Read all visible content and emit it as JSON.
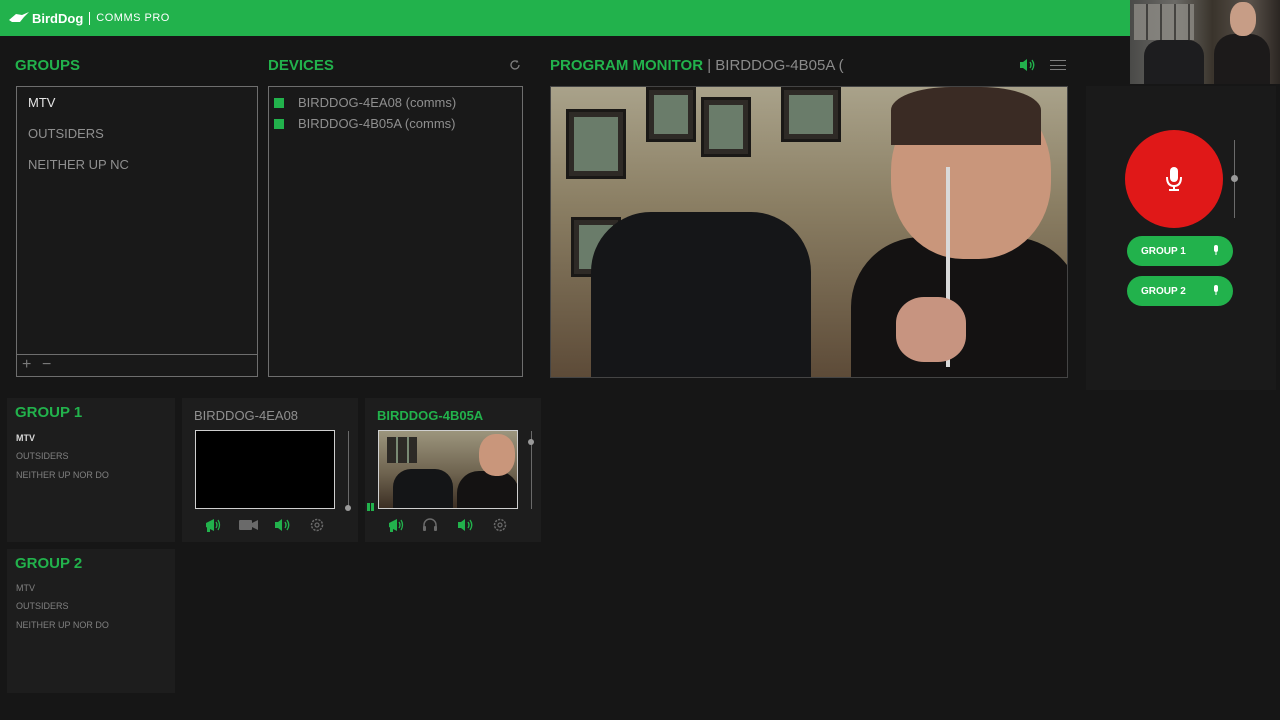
{
  "app": {
    "brand": "BirdDog",
    "product": "COMMS PRO"
  },
  "colors": {
    "accent": "#22b24c",
    "talk": "#e01818",
    "background": "#161616"
  },
  "groups_panel": {
    "title": "GROUPS",
    "items": [
      "MTV",
      "OUTSIDERS",
      "NEITHER UP NC"
    ],
    "add_label": "+",
    "remove_label": "−"
  },
  "devices_panel": {
    "title": "DEVICES",
    "items": [
      "BIRDDOG-4EA08 (comms)",
      "BIRDDOG-4B05A (comms)"
    ]
  },
  "program_monitor": {
    "title": "PROGRAM MONITOR",
    "source": "| BIRDDOG-4B05A ("
  },
  "talk_panel": {
    "groups": [
      "GROUP 1",
      "GROUP 2"
    ]
  },
  "group_cards": [
    {
      "title": "GROUP 1",
      "members": [
        "MTV",
        "OUTSIDERS",
        "NEITHER UP NOR DO"
      ],
      "devices": [
        {
          "name": "BIRDDOG-4EA08",
          "live": false
        },
        {
          "name": "BIRDDOG-4B05A",
          "live": true
        }
      ]
    },
    {
      "title": "GROUP 2",
      "members": [
        "MTV",
        "OUTSIDERS",
        "NEITHER UP NOR DO"
      ]
    }
  ]
}
